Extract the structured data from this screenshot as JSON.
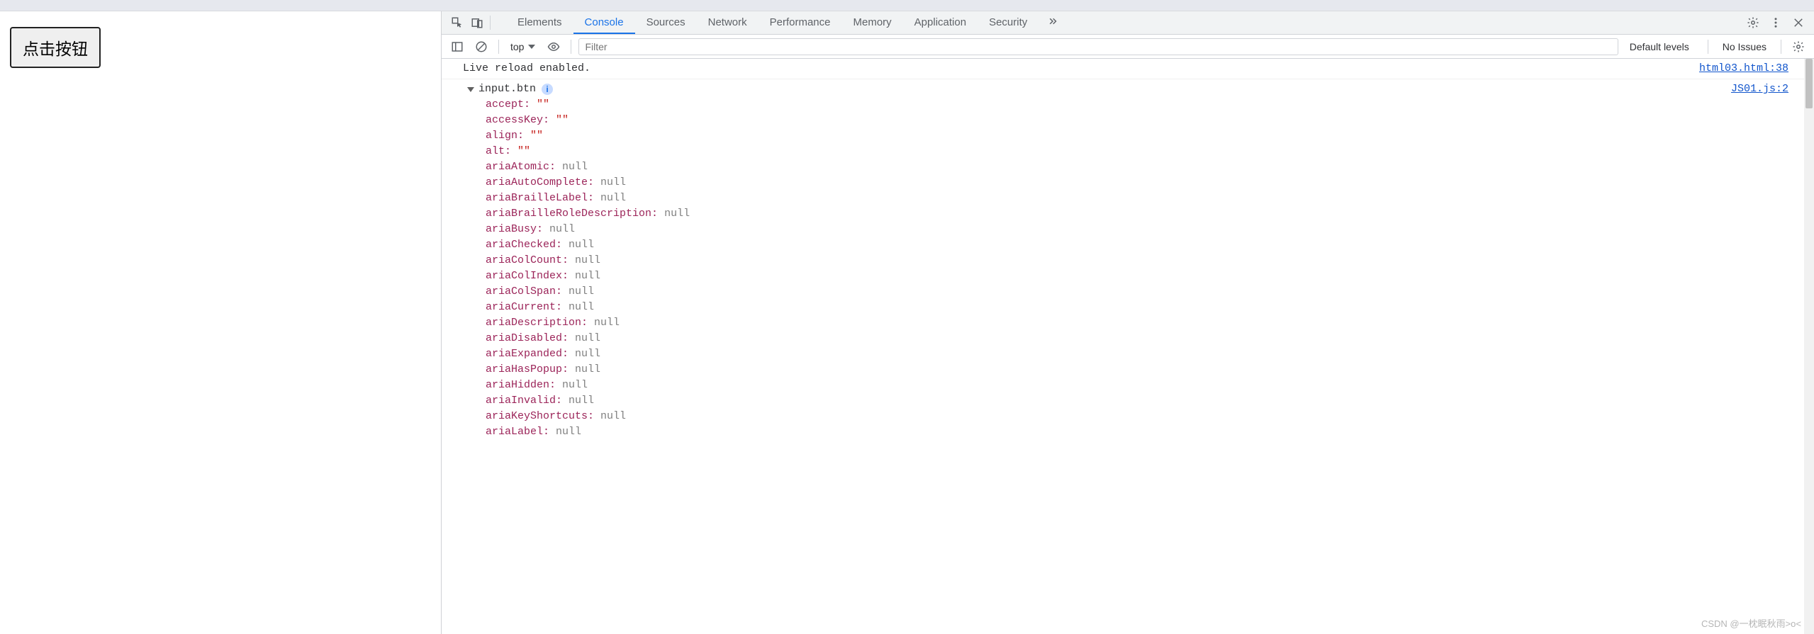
{
  "page": {
    "button_label": "点击按钮"
  },
  "devtools": {
    "tabs": [
      "Elements",
      "Console",
      "Sources",
      "Network",
      "Performance",
      "Memory",
      "Application",
      "Security"
    ],
    "active_tab": "Console",
    "toolbar": {
      "context": "top",
      "filter_placeholder": "Filter",
      "levels_label": "Default levels",
      "issues_label": "No Issues"
    },
    "log": {
      "message": "Live reload enabled.",
      "source": "html03.html:38"
    },
    "object": {
      "header": "input.btn",
      "source": "JS01.js:2",
      "properties": [
        {
          "key": "accept",
          "type": "string",
          "value": "\"\""
        },
        {
          "key": "accessKey",
          "type": "string",
          "value": "\"\""
        },
        {
          "key": "align",
          "type": "string",
          "value": "\"\""
        },
        {
          "key": "alt",
          "type": "string",
          "value": "\"\""
        },
        {
          "key": "ariaAtomic",
          "type": "null",
          "value": "null"
        },
        {
          "key": "ariaAutoComplete",
          "type": "null",
          "value": "null"
        },
        {
          "key": "ariaBrailleLabel",
          "type": "null",
          "value": "null"
        },
        {
          "key": "ariaBrailleRoleDescription",
          "type": "null",
          "value": "null"
        },
        {
          "key": "ariaBusy",
          "type": "null",
          "value": "null"
        },
        {
          "key": "ariaChecked",
          "type": "null",
          "value": "null"
        },
        {
          "key": "ariaColCount",
          "type": "null",
          "value": "null"
        },
        {
          "key": "ariaColIndex",
          "type": "null",
          "value": "null"
        },
        {
          "key": "ariaColSpan",
          "type": "null",
          "value": "null"
        },
        {
          "key": "ariaCurrent",
          "type": "null",
          "value": "null"
        },
        {
          "key": "ariaDescription",
          "type": "null",
          "value": "null"
        },
        {
          "key": "ariaDisabled",
          "type": "null",
          "value": "null"
        },
        {
          "key": "ariaExpanded",
          "type": "null",
          "value": "null"
        },
        {
          "key": "ariaHasPopup",
          "type": "null",
          "value": "null"
        },
        {
          "key": "ariaHidden",
          "type": "null",
          "value": "null"
        },
        {
          "key": "ariaInvalid",
          "type": "null",
          "value": "null"
        },
        {
          "key": "ariaKeyShortcuts",
          "type": "null",
          "value": "null"
        },
        {
          "key": "ariaLabel",
          "type": "null",
          "value": "null"
        }
      ]
    }
  },
  "watermark": "CSDN @一枕眠秋雨>o<"
}
